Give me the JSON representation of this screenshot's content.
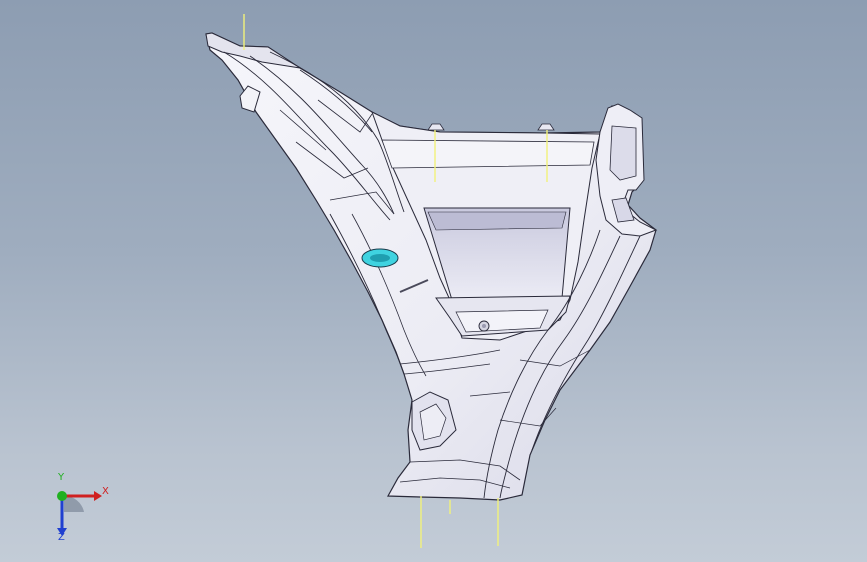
{
  "viewport": {
    "background_top": "#8d9db2",
    "background_bottom": "#c3ccd7",
    "part_fill": "#f1f1f7",
    "part_shade": "#d6d6e6",
    "edge_color": "#2a2a3a",
    "marker_color": "#f2f27a",
    "label_badge_color": "#3fd3e0"
  },
  "triad": {
    "x_label": "X",
    "y_label": "Y",
    "z_label": "Z",
    "x_color": "#d02020",
    "y_color": "#20b020",
    "z_color": "#2040d0"
  }
}
